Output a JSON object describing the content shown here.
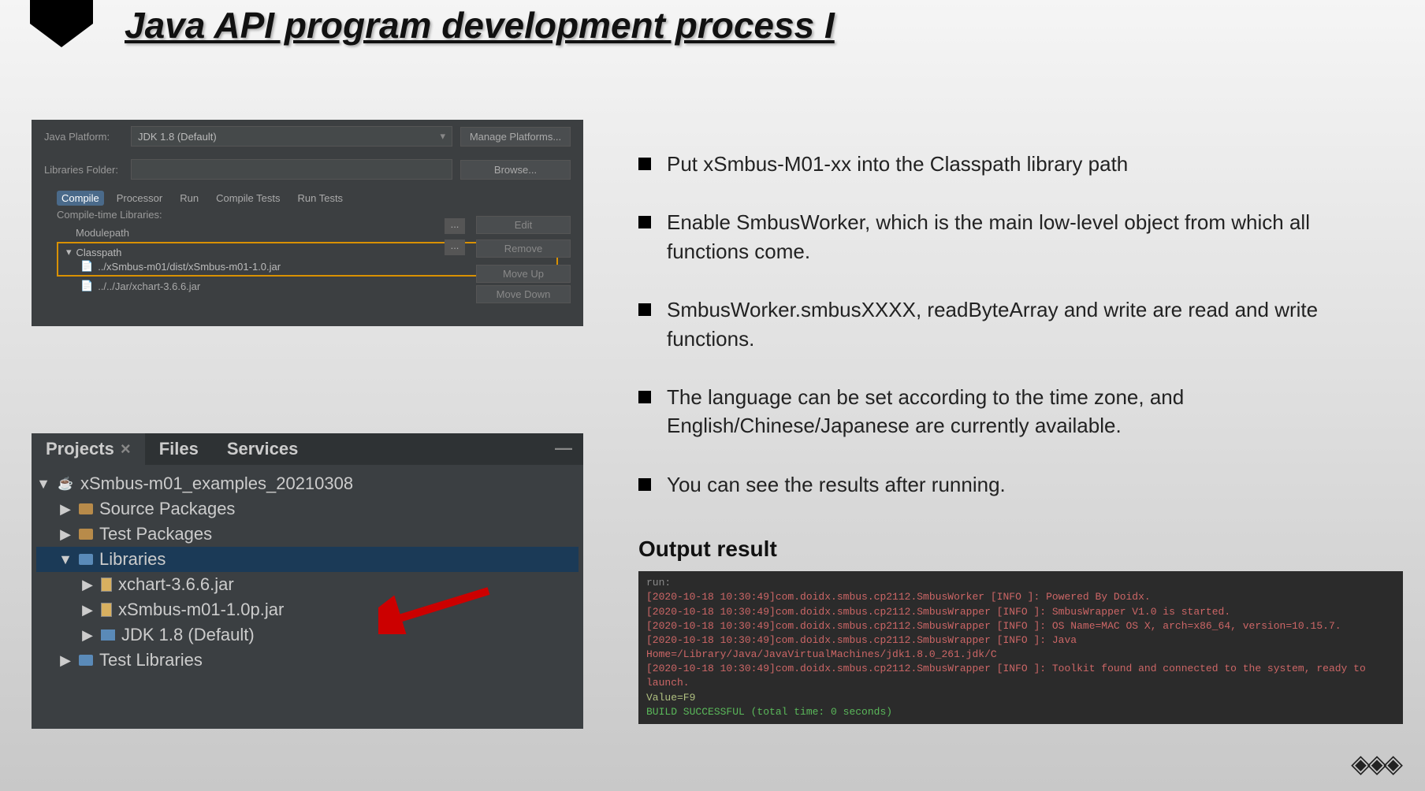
{
  "title": "Java API program development process I",
  "ss1": {
    "platform_label": "Java Platform:",
    "platform_value": "JDK 1.8 (Default)",
    "manage_btn": "Manage Platforms...",
    "libfolder_label": "Libraries Folder:",
    "libfolder_value": "",
    "browse_btn": "Browse...",
    "tabs": [
      "Compile",
      "Processor",
      "Run",
      "Compile Tests",
      "Run Tests"
    ],
    "libs_label": "Compile-time Libraries:",
    "modulepath": "Modulepath",
    "classpath": "Classpath",
    "classpath_item": "../xSmbus-m01/dist/xSmbus-m01-1.0.jar",
    "jar_item": "../../Jar/xchart-3.6.6.jar",
    "btn_edit": "Edit",
    "btn_remove": "Remove",
    "btn_up": "Move Up",
    "btn_down": "Move Down"
  },
  "ss2": {
    "tabs": [
      "Projects",
      "Files",
      "Services"
    ],
    "root": "xSmbus-m01_examples_20210308",
    "nodes": {
      "src": "Source Packages",
      "test": "Test Packages",
      "lib": "Libraries",
      "jar1": "xchart-3.6.6.jar",
      "jar2": "xSmbus-m01-1.0p.jar",
      "jdk": "JDK 1.8 (Default)",
      "testlib": "Test Libraries"
    }
  },
  "bullets": [
    "Put xSmbus-M01-xx into the Classpath library path",
    "Enable SmbusWorker, which is the main low-level object from which all functions come.",
    "SmbusWorker.smbusXXXX, readByteArray and write are read and write functions.",
    "The language can be set according to the time zone, and English/Chinese/Japanese are currently available.",
    "You can see the results after running."
  ],
  "output_title": "Output result",
  "terminal": {
    "run": "run:",
    "l1": "[2020-10-18 10:30:49]com.doidx.smbus.cp2112.SmbusWorker [INFO ]: Powered By Doidx.",
    "l2": "[2020-10-18 10:30:49]com.doidx.smbus.cp2112.SmbusWrapper [INFO ]: SmbusWrapper V1.0 is started.",
    "l3": "[2020-10-18 10:30:49]com.doidx.smbus.cp2112.SmbusWrapper [INFO ]: OS Name=MAC OS X, arch=x86_64, version=10.15.7.",
    "l4": "[2020-10-18 10:30:49]com.doidx.smbus.cp2112.SmbusWrapper [INFO ]: Java Home=/Library/Java/JavaVirtualMachines/jdk1.8.0_261.jdk/C",
    "l5": "[2020-10-18 10:30:49]com.doidx.smbus.cp2112.SmbusWrapper [INFO ]: Toolkit found and connected to the system, ready to launch.",
    "val": "Value=F9",
    "ok": "BUILD SUCCESSFUL (total time: 0 seconds)"
  }
}
